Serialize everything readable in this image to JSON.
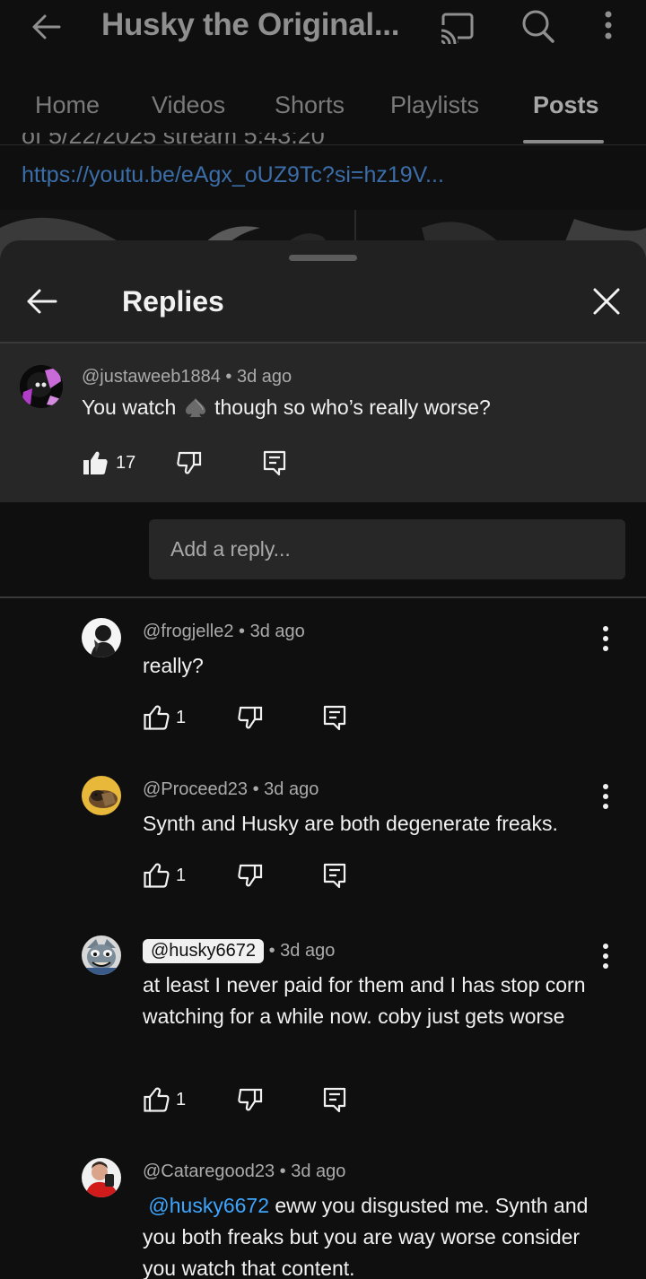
{
  "topbar": {
    "title": "Husky the Original...",
    "icons": [
      "back-arrow-icon",
      "cast-icon",
      "search-icon",
      "more-vert-icon"
    ]
  },
  "tabs": [
    {
      "label": "Home",
      "active": false
    },
    {
      "label": "Videos",
      "active": false
    },
    {
      "label": "Shorts",
      "active": false
    },
    {
      "label": "Playlists",
      "active": false
    },
    {
      "label": "Posts",
      "active": true
    }
  ],
  "post": {
    "text_partial": "of 5/22/2025 stream 5:43:20",
    "link": "https://youtu.be/eAgx_oUZ9Tc?si=hz19V..."
  },
  "sheet": {
    "title": "Replies",
    "icons": [
      "back-arrow-icon",
      "close-icon"
    ]
  },
  "parent_comment": {
    "author": "@justaweeb1884",
    "time": "3d ago",
    "text_before": "You watch",
    "text_after": "though so who’s really worse?",
    "inline_icon": "spade-icon",
    "likes": "17"
  },
  "reply_box": {
    "placeholder": "Add a reply..."
  },
  "replies": [
    {
      "author": "@frogjelle2",
      "time": "3d ago",
      "text": "really?",
      "likes": "1"
    },
    {
      "author": "@Proceed23",
      "time": "3d ago",
      "text": "Synth and Husky are both degenerate freaks.",
      "likes": "1"
    },
    {
      "author": "@husky6672",
      "time": "3d ago",
      "text": "at least I never paid for them and I has stop corn watching for a while now. coby just gets worse",
      "likes": "1"
    },
    {
      "author": "@Cataregood23",
      "time": "3d ago",
      "mention": "@husky6672",
      "text": "eww you disgusted me. Synth and you both freaks but you are way worse consider you watch that content."
    }
  ],
  "colors": {
    "background": "#0f0f0f",
    "sheet": "#212121",
    "parent_highlight": "#272727",
    "link": "#3ea6ff",
    "secondary_text": "#aaaaaa"
  }
}
